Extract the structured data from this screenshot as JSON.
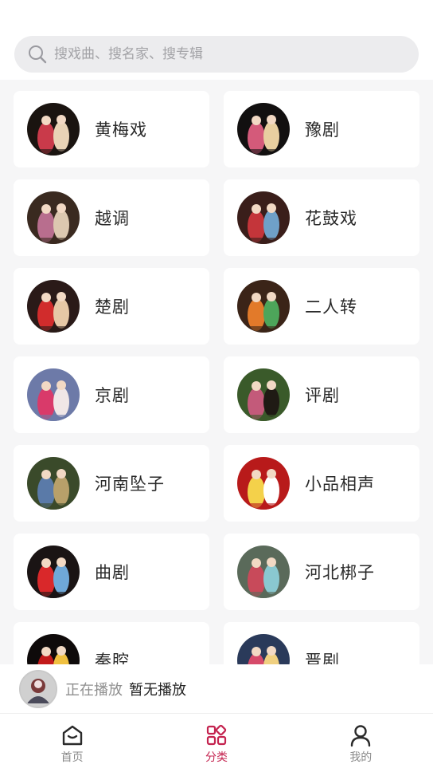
{
  "search": {
    "placeholder": "搜戏曲、搜名家、搜专辑",
    "icon": "search-icon"
  },
  "categories": [
    {
      "label": "黄梅戏",
      "thumb_colors": [
        "#1a1410",
        "#c93a4a",
        "#e9d3b6"
      ]
    },
    {
      "label": "豫剧",
      "thumb_colors": [
        "#121010",
        "#d45a7a",
        "#e8cfa0"
      ]
    },
    {
      "label": "越调",
      "thumb_colors": [
        "#3a2a20",
        "#b86e8e",
        "#dcc8b0"
      ]
    },
    {
      "label": "花鼓戏",
      "thumb_colors": [
        "#3a1e1a",
        "#c4353a",
        "#6fa0c8"
      ]
    },
    {
      "label": "楚剧",
      "thumb_colors": [
        "#2a1a18",
        "#d12c2c",
        "#e6c8a6"
      ]
    },
    {
      "label": "二人转",
      "thumb_colors": [
        "#3b2418",
        "#e27a2a",
        "#4da55a"
      ]
    },
    {
      "label": "京剧",
      "thumb_colors": [
        "#6d7aa8",
        "#d93a6a",
        "#f0e6e6"
      ]
    },
    {
      "label": "评剧",
      "thumb_colors": [
        "#3a5a2a",
        "#c35a7a",
        "#1f1a14"
      ]
    },
    {
      "label": "河南坠子",
      "thumb_colors": [
        "#3a4a2a",
        "#5a7aa8",
        "#b8a06a"
      ]
    },
    {
      "label": "小品相声",
      "thumb_colors": [
        "#b81a1a",
        "#f4d14a",
        "#ffffff"
      ]
    },
    {
      "label": "曲剧",
      "thumb_colors": [
        "#1a1414",
        "#d9282a",
        "#6fa8d8"
      ]
    },
    {
      "label": "河北梆子",
      "thumb_colors": [
        "#5a6a5a",
        "#c84a5a",
        "#8ac8d0"
      ]
    },
    {
      "label": "秦腔",
      "thumb_colors": [
        "#0e0a0a",
        "#c21a1a",
        "#f0c040"
      ]
    },
    {
      "label": "晋剧",
      "thumb_colors": [
        "#2a3a5a",
        "#d64a6a",
        "#f0d080"
      ]
    }
  ],
  "player": {
    "label": "正在播放",
    "status": "暂无播放"
  },
  "tabs": [
    {
      "label": "首页",
      "icon": "home-icon",
      "active": false
    },
    {
      "label": "分类",
      "icon": "category-icon",
      "active": true
    },
    {
      "label": "我的",
      "icon": "profile-icon",
      "active": false
    }
  ],
  "colors": {
    "accent": "#c4234f",
    "background": "#f6f6f7",
    "card": "#ffffff"
  }
}
